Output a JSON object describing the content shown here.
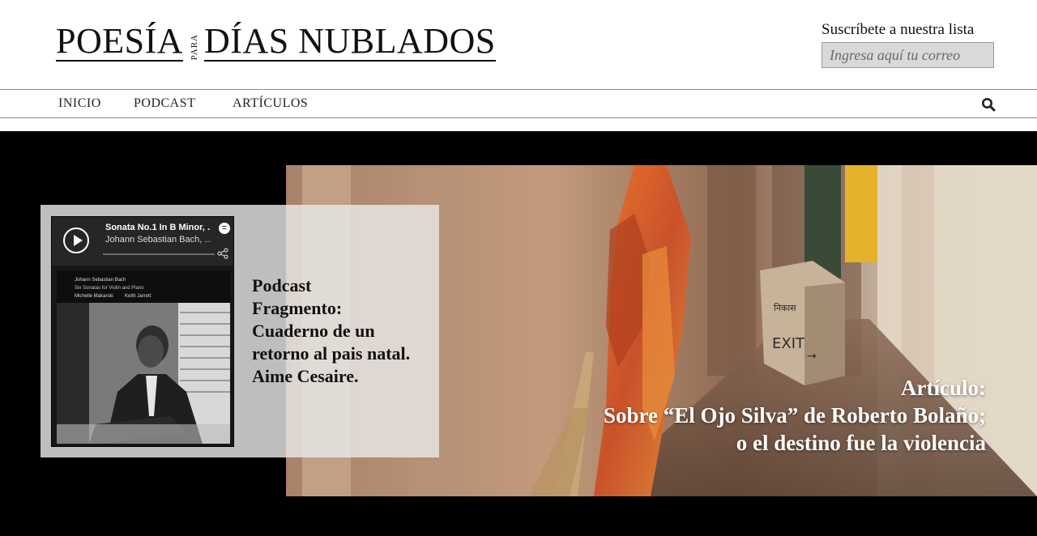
{
  "site": {
    "logo_part1": "POESÍA",
    "logo_para": "PARA",
    "logo_part2": "DÍAS NUBLADOS"
  },
  "subscribe": {
    "label": "Suscríbete a nuestra lista",
    "placeholder": "Ingresa aquí tu correo"
  },
  "nav": {
    "items": [
      "INICIO",
      "PODCAST",
      "ARTÍCULOS"
    ],
    "search_icon": "search-icon"
  },
  "podcast": {
    "lines": [
      "Podcast",
      "Fragmento:",
      "Cuaderno de un",
      "retorno al pais natal.",
      "Aime Cesaire."
    ],
    "player": {
      "track_title": "Sonata No.1 In B Minor, ...",
      "track_artist": "Johann Sebastian Bach, ...",
      "cover_composer": "Johann Sebastian Bach",
      "cover_album": "Six Sonatas for Violin and Piano",
      "cover_performer1": "Michelle Makarski",
      "cover_performer2": "Keith Jarrett",
      "play_icon": "play-icon",
      "logo_icon": "spotify-logo-icon",
      "share_icon": "share-icon"
    }
  },
  "article": {
    "lines": [
      "Artículo:",
      "Sobre “El Ojo Silva” de Roberto Bolaño;",
      "o el destino fue la violencia"
    ]
  },
  "colors": {
    "hero_background": "#000000",
    "card_background": "#e8e8e8",
    "input_background": "#d9d9d9",
    "player_background": "#262626"
  }
}
